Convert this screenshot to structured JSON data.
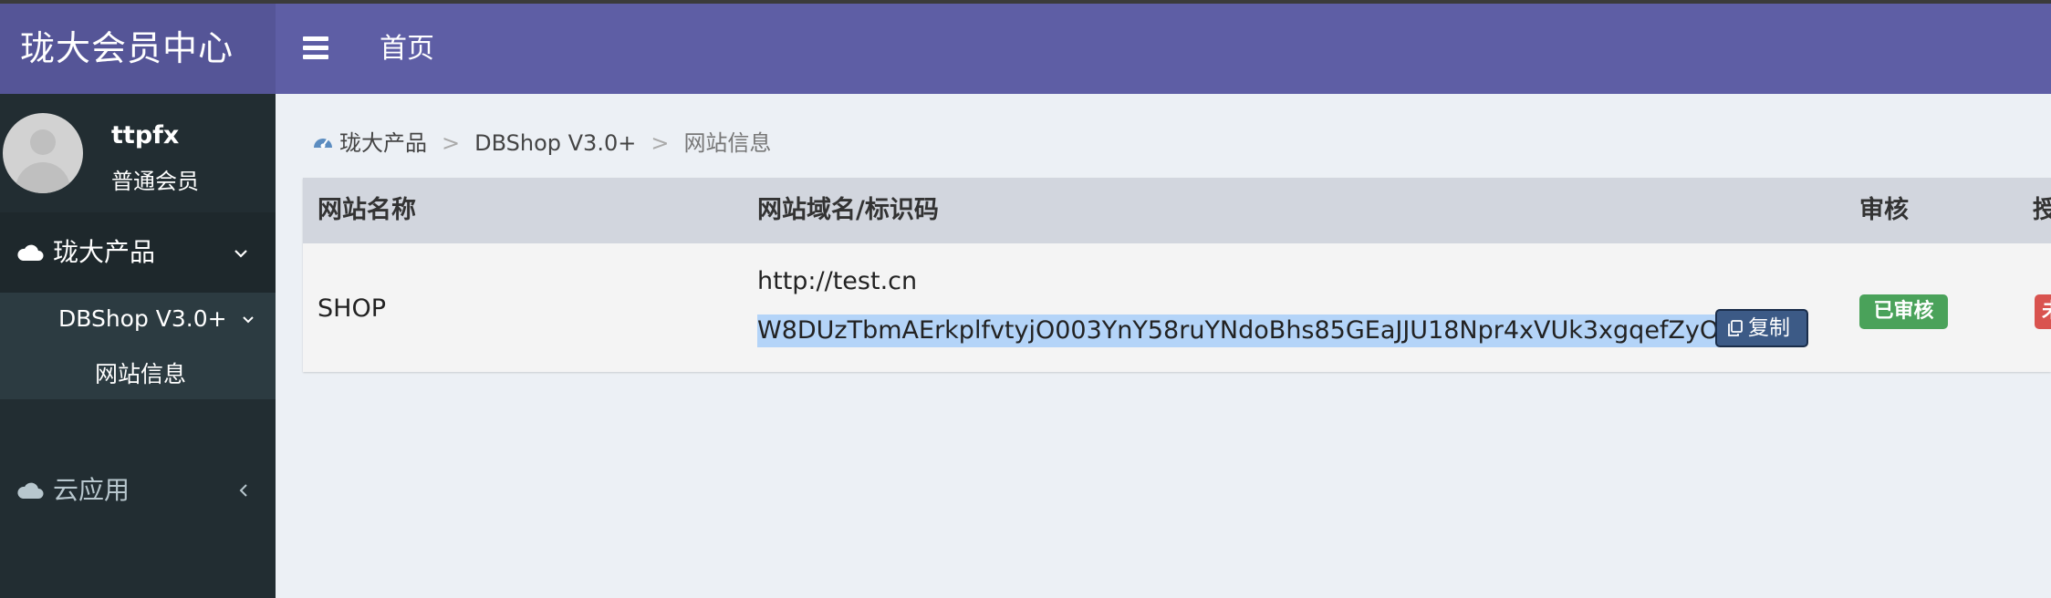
{
  "app": {
    "logo_text": "珑大会员中心"
  },
  "navbar": {
    "home_label": "首页"
  },
  "user": {
    "name": "ttpfx",
    "role": "普通会员"
  },
  "sidebar": {
    "items": [
      {
        "label": "珑大产品",
        "icon": "cloud-icon",
        "chevron": "⌄"
      },
      {
        "label": "云应用",
        "icon": "cloud-icon",
        "chevron": "‹"
      }
    ],
    "submenu": {
      "group_label": "DBShop V3.0+",
      "item_label": "网站信息"
    }
  },
  "breadcrumb": {
    "items": [
      "珑大产品",
      "DBShop V3.0+",
      "网站信息"
    ],
    "separator": ">"
  },
  "table": {
    "headers": [
      "网站名称",
      "网站域名/标识码",
      "审核",
      "授"
    ],
    "row": {
      "site_name": "SHOP",
      "domain": "http://test.cn",
      "identifier": "W8DUzTbmAErkplfvtyjO003YnY58ruYNdoBhs85GEaJJU18Npr4xVUk3xgqefZyO",
      "copy_label": "复制",
      "review_status": "已审核",
      "auth_status": "未"
    }
  },
  "colors": {
    "logo_bg": "#555597",
    "navbar_bg": "#5e5ea5",
    "sidebar_bg": "#222d32",
    "approved_badge": "#4aa25a",
    "warning_badge": "#d9534f",
    "selection": "#b4d4f8"
  }
}
